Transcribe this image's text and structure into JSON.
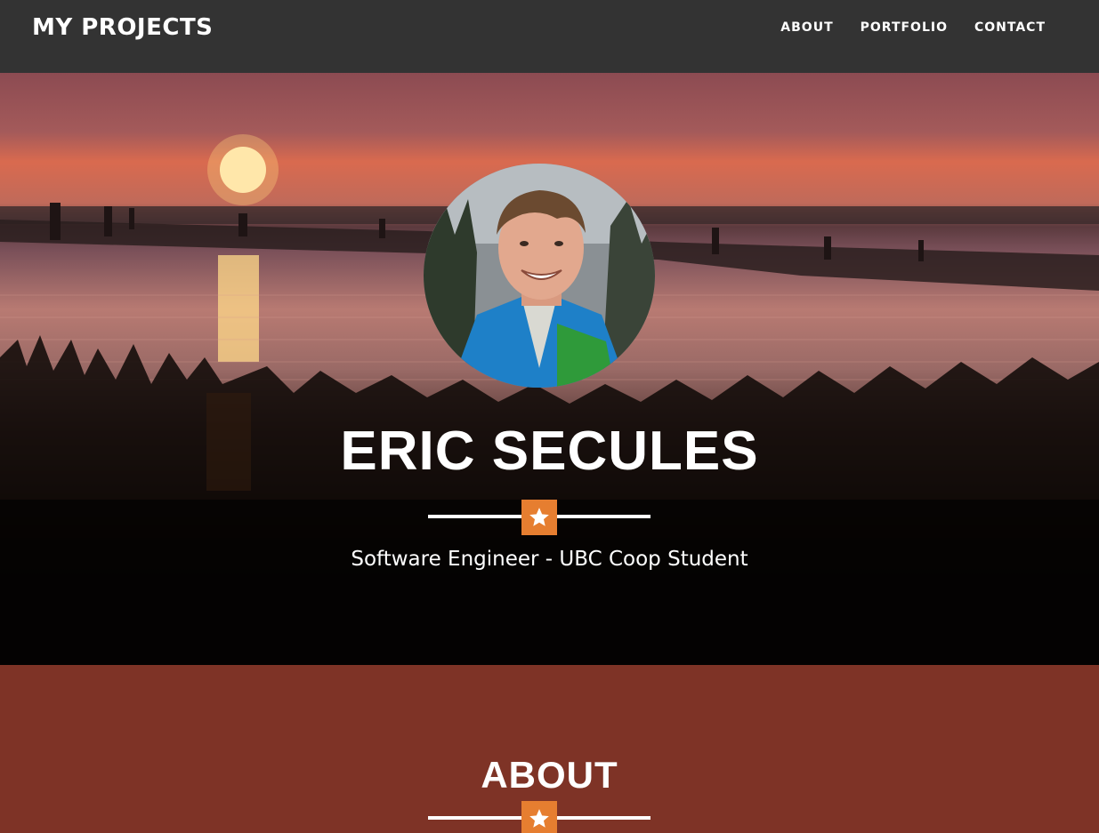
{
  "navbar": {
    "brand": "MY PROJECTS",
    "links": [
      "ABOUT",
      "PORTFOLIO",
      "CONTACT"
    ]
  },
  "hero": {
    "name": "ERIC SECULES",
    "subtitle": "Software Engineer - UBC Coop Student",
    "divider_icon": "star-icon"
  },
  "about": {
    "title": "ABOUT",
    "divider_icon": "star-icon"
  },
  "colors": {
    "navbar_bg": "#333333",
    "accent": "#e67e30",
    "about_bg": "#7e3326"
  }
}
